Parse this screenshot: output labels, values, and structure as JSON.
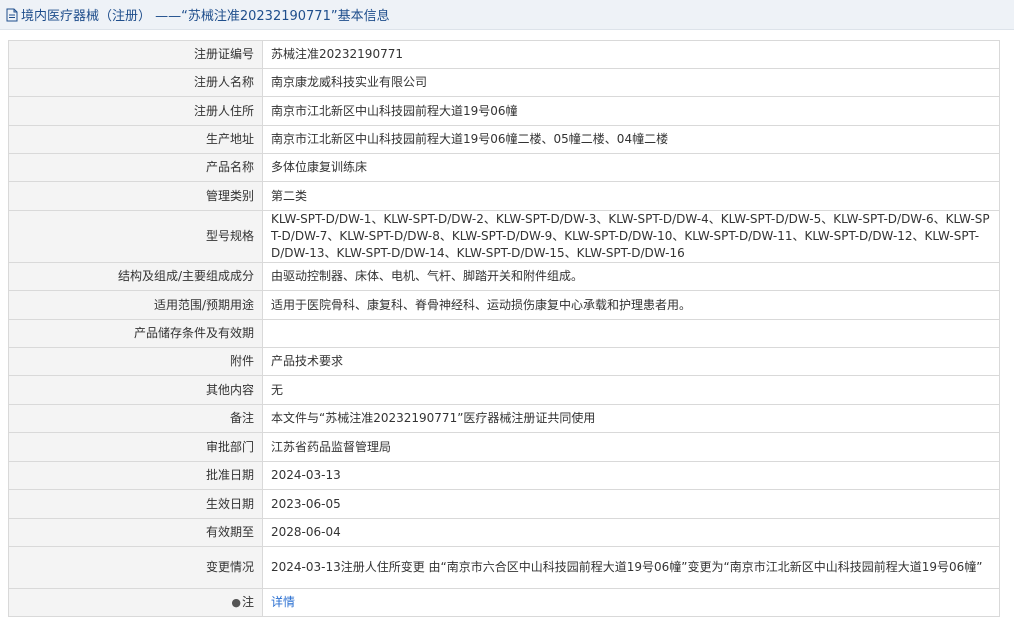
{
  "header": {
    "title": "境内医疗器械（注册） ——“苏械注准20232190771”基本信息",
    "icon": "document-icon",
    "accent": "#1f4e8c"
  },
  "rows": [
    {
      "label": "注册证编号",
      "value": "苏械注准20232190771"
    },
    {
      "label": "注册人名称",
      "value": "南京康龙威科技实业有限公司"
    },
    {
      "label": "注册人住所",
      "value": "南京市江北新区中山科技园前程大道19号06幢"
    },
    {
      "label": "生产地址",
      "value": "南京市江北新区中山科技园前程大道19号06幢二楼、05幢二楼、04幢二楼"
    },
    {
      "label": "产品名称",
      "value": "多体位康复训练床"
    },
    {
      "label": "管理类别",
      "value": "第二类"
    },
    {
      "label": "型号规格",
      "value": "KLW-SPT-D/DW-1、KLW-SPT-D/DW-2、KLW-SPT-D/DW-3、KLW-SPT-D/DW-4、KLW-SPT-D/DW-5、KLW-SPT-D/DW-6、KLW-SPT-D/DW-7、KLW-SPT-D/DW-8、KLW-SPT-D/DW-9、KLW-SPT-D/DW-10、KLW-SPT-D/DW-11、KLW-SPT-D/DW-12、KLW-SPT-D/DW-13、KLW-SPT-D/DW-14、KLW-SPT-D/DW-15、KLW-SPT-D/DW-16"
    },
    {
      "label": "结构及组成/主要组成成分",
      "value": "由驱动控制器、床体、电机、气杆、脚踏开关和附件组成。"
    },
    {
      "label": "适用范围/预期用途",
      "value": "适用于医院骨科、康复科、脊骨神经科、运动损伤康复中心承载和护理患者用。"
    },
    {
      "label": "产品储存条件及有效期",
      "value": ""
    },
    {
      "label": "附件",
      "value": "产品技术要求"
    },
    {
      "label": "其他内容",
      "value": "无"
    },
    {
      "label": "备注",
      "value": "本文件与“苏械注准20232190771”医疗器械注册证共同使用"
    },
    {
      "label": "审批部门",
      "value": "江苏省药品监督管理局"
    },
    {
      "label": "批准日期",
      "value": "2024-03-13"
    },
    {
      "label": "生效日期",
      "value": "2023-06-05"
    },
    {
      "label": "有效期至",
      "value": "2028-06-04"
    },
    {
      "label": "变更情况",
      "value": "2024-03-13注册人住所变更 由“南京市六合区中山科技园前程大道19号06幢”变更为“南京市江北新区中山科技园前程大道19号06幢”"
    }
  ],
  "note_row": {
    "label": "注",
    "icon": "pin-icon",
    "link_text": "详情"
  },
  "colors": {
    "label_bg": "#f4f4f4",
    "border": "#d9d9d9",
    "link": "#2a6fd1"
  }
}
